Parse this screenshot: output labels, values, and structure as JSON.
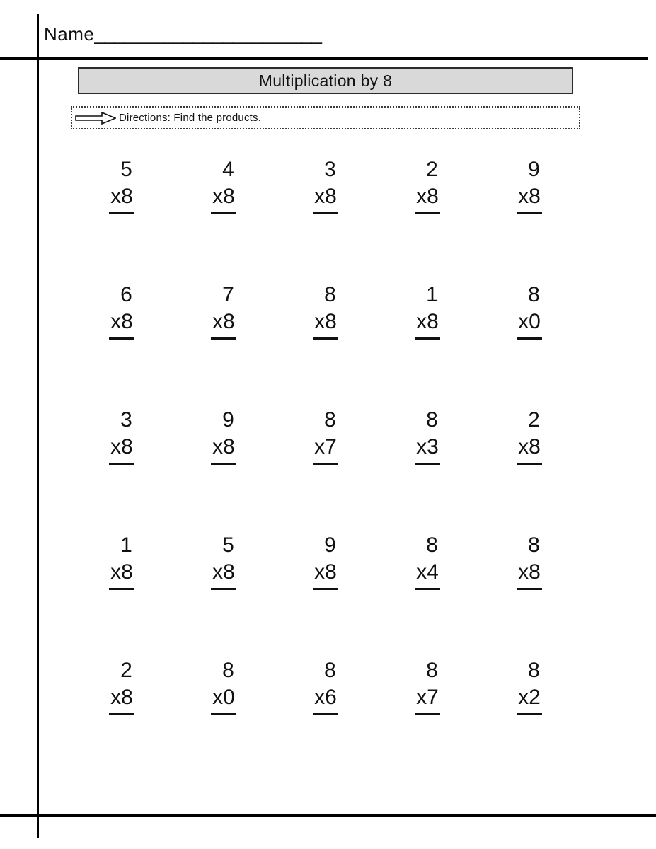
{
  "worksheet": {
    "name_label": "Name",
    "name_blank": "_______________________",
    "title": "Multiplication by 8",
    "directions": "Directions: Find the products.",
    "arrow_icon": "right-arrow-outline-icon",
    "footer_note": "",
    "colors": {
      "title_bar_fill": "#d9d9d9",
      "title_bar_border": "#2b2b2b",
      "rule": "#000000",
      "ink": "#111111",
      "page": "#ffffff"
    }
  },
  "problems": {
    "columns": 5,
    "rows": 5,
    "operator": "x",
    "grid": [
      [
        {
          "top": "5",
          "bottom": "x8"
        },
        {
          "top": "4",
          "bottom": "x8"
        },
        {
          "top": "3",
          "bottom": "x8"
        },
        {
          "top": "2",
          "bottom": "x8"
        },
        {
          "top": "9",
          "bottom": "x8"
        }
      ],
      [
        {
          "top": "6",
          "bottom": "x8"
        },
        {
          "top": "7",
          "bottom": "x8"
        },
        {
          "top": "8",
          "bottom": "x8"
        },
        {
          "top": "1",
          "bottom": "x8"
        },
        {
          "top": "8",
          "bottom": "x0"
        }
      ],
      [
        {
          "top": "3",
          "bottom": "x8"
        },
        {
          "top": "9",
          "bottom": "x8"
        },
        {
          "top": "8",
          "bottom": "x7"
        },
        {
          "top": "8",
          "bottom": "x3"
        },
        {
          "top": "2",
          "bottom": "x8"
        }
      ],
      [
        {
          "top": "1",
          "bottom": "x8"
        },
        {
          "top": "5",
          "bottom": "x8"
        },
        {
          "top": "9",
          "bottom": "x8"
        },
        {
          "top": "8",
          "bottom": "x4"
        },
        {
          "top": "8",
          "bottom": "x8"
        }
      ],
      [
        {
          "top": "2",
          "bottom": "x8"
        },
        {
          "top": "8",
          "bottom": "x0"
        },
        {
          "top": "8",
          "bottom": "x6"
        },
        {
          "top": "8",
          "bottom": "x7"
        },
        {
          "top": "8",
          "bottom": "x2"
        }
      ]
    ]
  }
}
